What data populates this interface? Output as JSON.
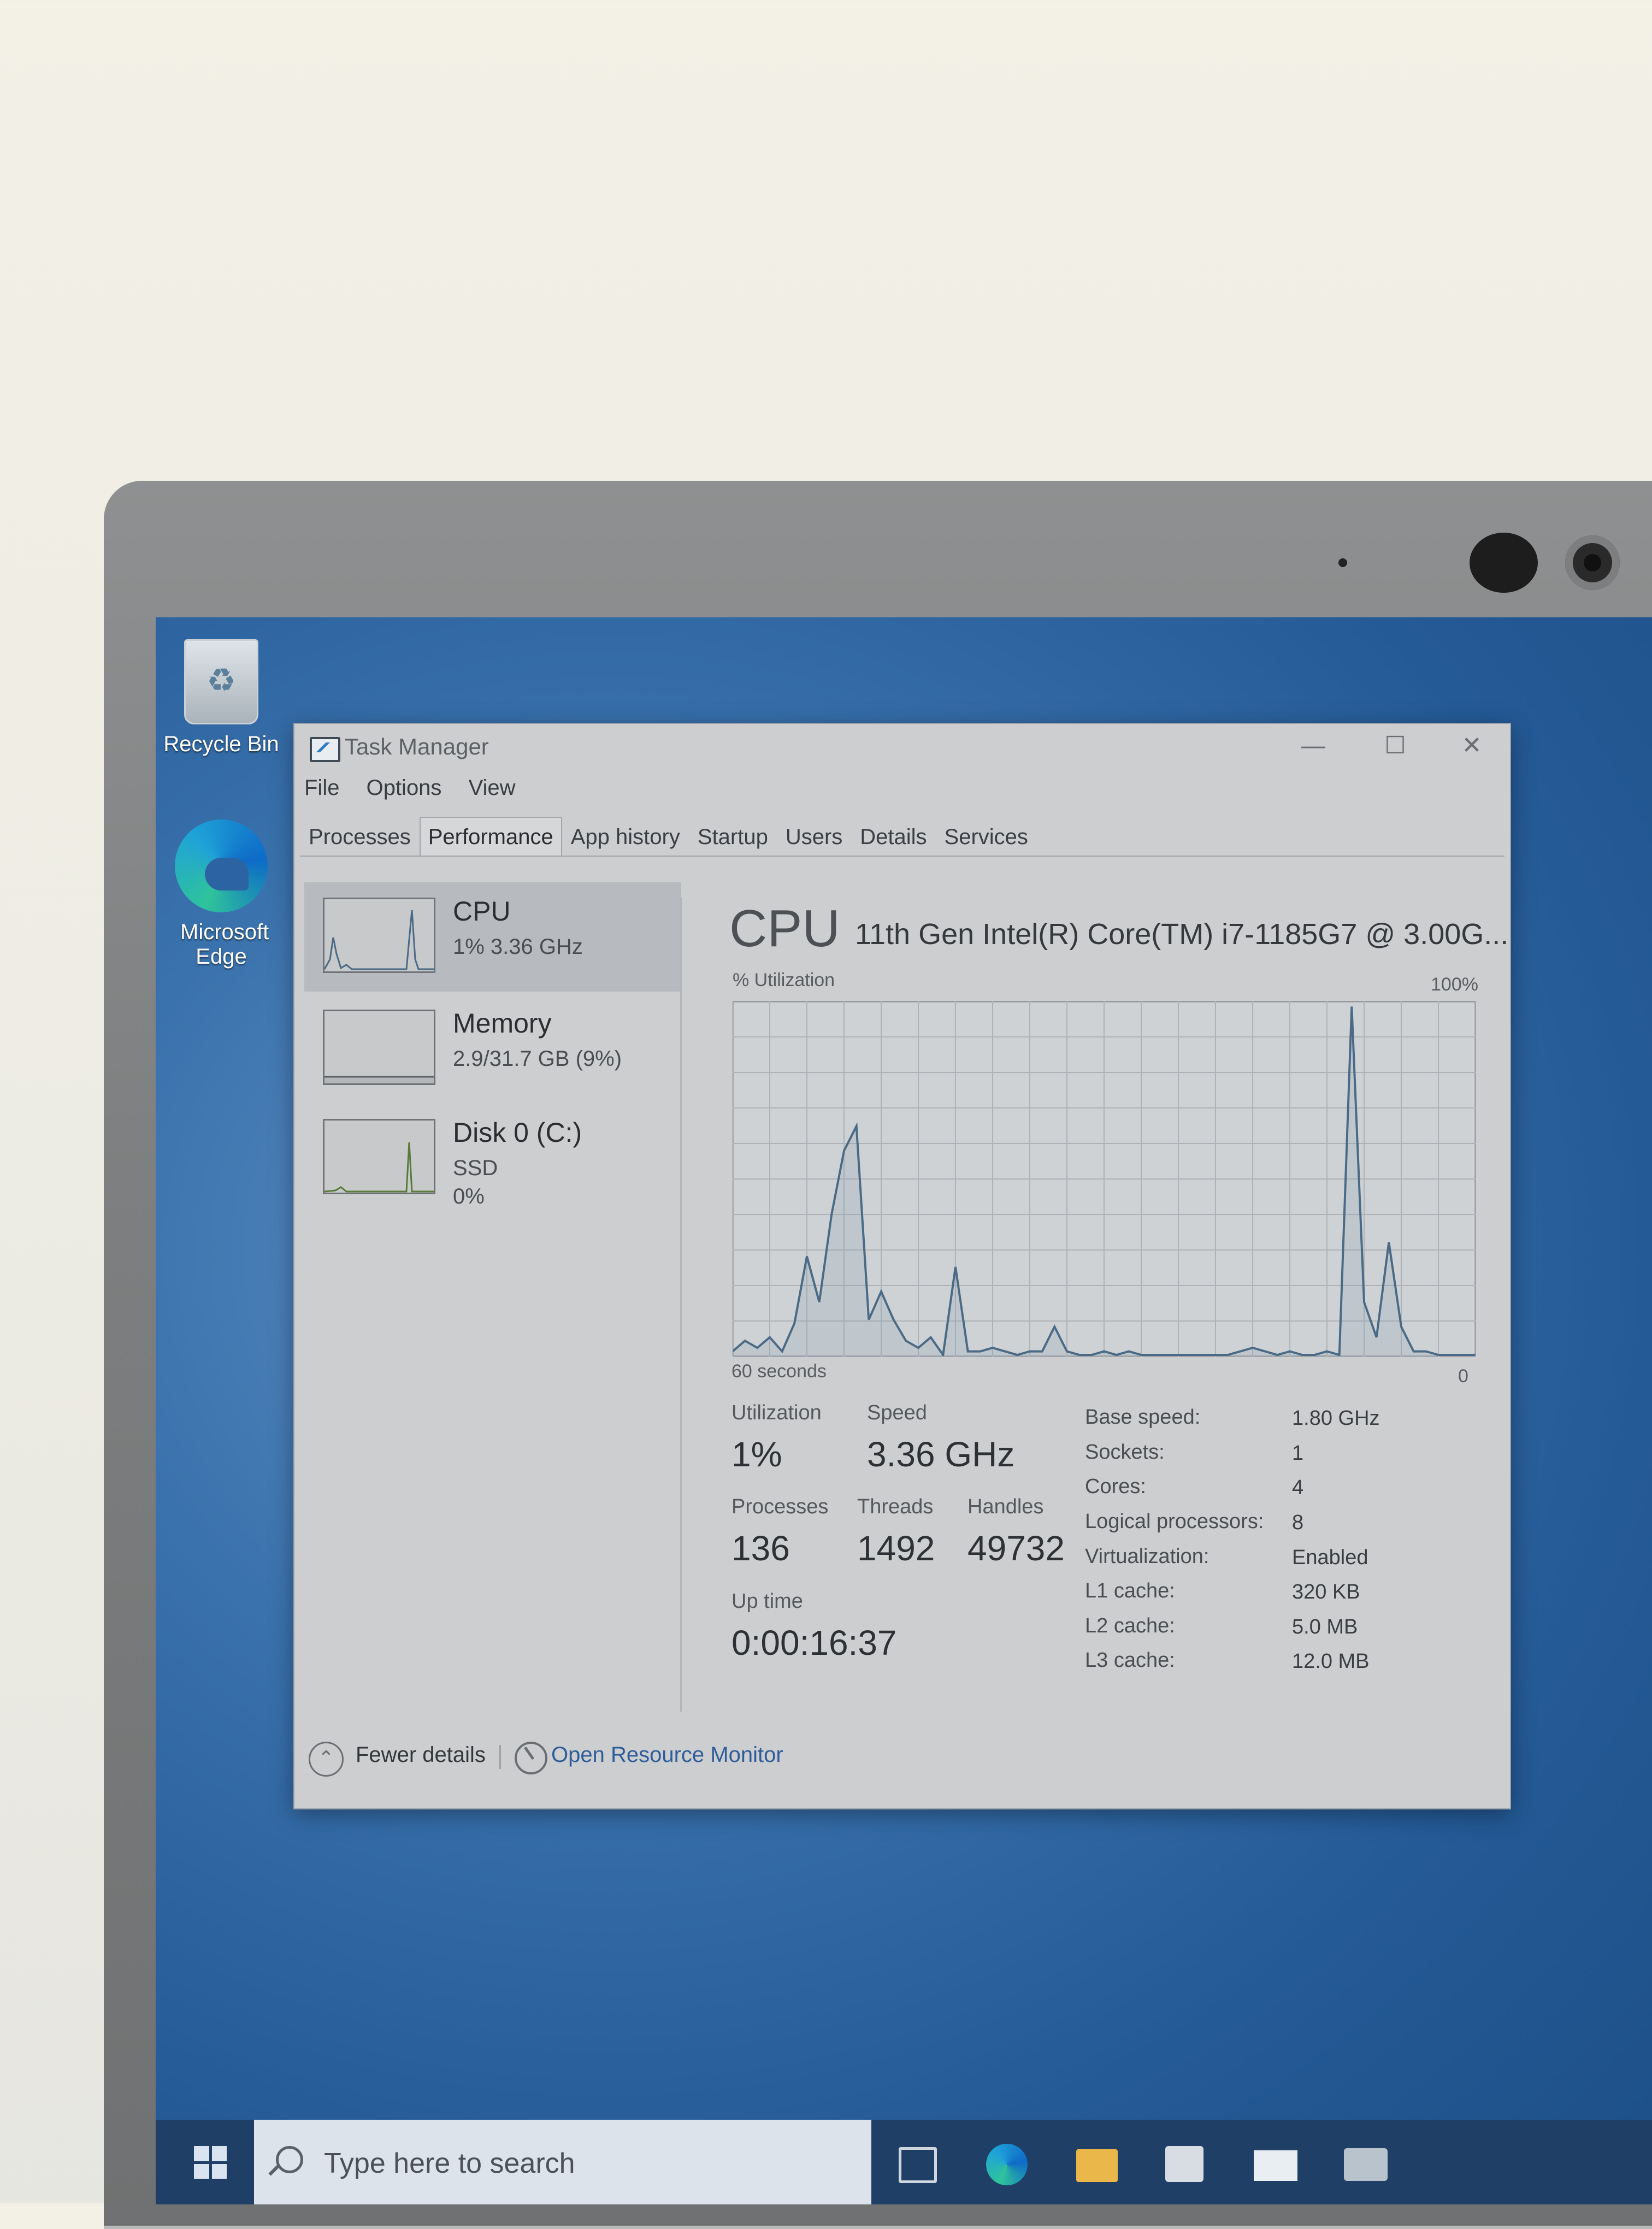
{
  "desktop": {
    "icons": [
      {
        "label": "Recycle Bin"
      },
      {
        "label": "Microsoft Edge"
      }
    ]
  },
  "window": {
    "title": "Task Manager",
    "controls": {
      "minimize": "—",
      "maximize": "☐",
      "close": "✕"
    }
  },
  "menu": [
    "File",
    "Options",
    "View"
  ],
  "tabs": [
    "Processes",
    "Performance",
    "App history",
    "Startup",
    "Users",
    "Details",
    "Services"
  ],
  "active_tab": "Performance",
  "sidebar": [
    {
      "title": "CPU",
      "sub1": "1% 3.36 GHz",
      "sub2": "",
      "selected": true
    },
    {
      "title": "Memory",
      "sub1": "2.9/31.7 GB (9%)",
      "sub2": "",
      "selected": false
    },
    {
      "title": "Disk 0 (C:)",
      "sub1": "SSD",
      "sub2": "0%",
      "selected": false
    }
  ],
  "detail": {
    "heading": "CPU",
    "model": "11th Gen Intel(R) Core(TM) i7-1185G7 @ 3.00G...",
    "graph_label_top_left": "% Utilization",
    "graph_label_top_right": "100%",
    "graph_label_bottom_left": "60 seconds",
    "graph_label_bottom_right": "0"
  },
  "chart_data": {
    "type": "line",
    "title": "",
    "xlabel": "60 seconds",
    "ylabel": "% Utilization",
    "ylim": [
      0,
      100
    ],
    "grid": true,
    "series": [
      {
        "values": [
          1,
          4,
          2,
          5,
          1,
          9,
          28,
          15,
          40,
          58,
          65,
          10,
          18,
          10,
          4,
          2,
          5,
          0,
          25,
          1,
          1,
          2,
          1,
          0,
          1,
          1,
          8,
          1,
          0,
          0,
          1,
          0,
          1,
          0,
          0,
          0,
          0,
          0,
          0,
          0,
          0,
          1,
          2,
          1,
          0,
          1,
          0,
          0,
          1,
          0,
          99,
          15,
          5,
          32,
          8,
          1,
          1,
          0,
          0,
          0,
          0
        ]
      }
    ]
  },
  "stats": {
    "utilization_label": "Utilization",
    "utilization_value": "1%",
    "speed_label": "Speed",
    "speed_value": "3.36 GHz",
    "processes_label": "Processes",
    "processes_value": "136",
    "threads_label": "Threads",
    "threads_value": "1492",
    "handles_label": "Handles",
    "handles_value": "49732",
    "uptime_label": "Up time",
    "uptime_value": "0:00:16:37"
  },
  "specs": [
    {
      "label": "Base speed:",
      "value": "1.80 GHz"
    },
    {
      "label": "Sockets:",
      "value": "1"
    },
    {
      "label": "Cores:",
      "value": "4"
    },
    {
      "label": "Logical processors:",
      "value": "8"
    },
    {
      "label": "Virtualization:",
      "value": "Enabled"
    },
    {
      "label": "L1 cache:",
      "value": "320 KB"
    },
    {
      "label": "L2 cache:",
      "value": "5.0 MB"
    },
    {
      "label": "L3 cache:",
      "value": "12.0 MB"
    }
  ],
  "footer": {
    "fewer_details": "Fewer details",
    "open_resource_monitor": "Open Resource Monitor"
  },
  "taskbar": {
    "search_placeholder": "Type here to search"
  },
  "colors": {
    "desktop_blue": "#3a72ad",
    "window_bg": "#ccced0",
    "graph_line": "#4a6a86",
    "link": "#2f5d9a"
  }
}
